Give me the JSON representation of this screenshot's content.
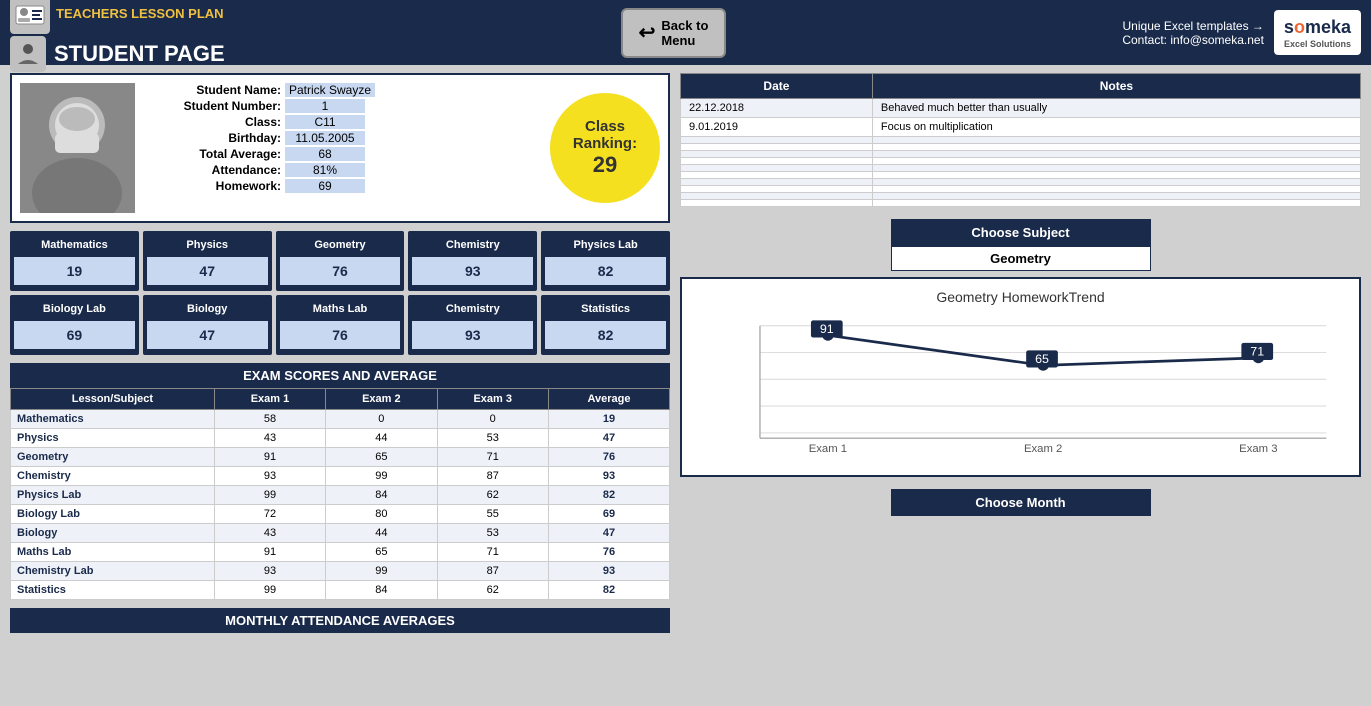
{
  "header": {
    "top_title": "TEACHERS LESSON PLAN",
    "bottom_title": "STUDENT PAGE",
    "back_label": "Back to",
    "back_label2": "Menu",
    "unique_text": "Unique Excel templates →",
    "contact_text": "Contact: info@someka.net",
    "brand_name": "someka",
    "brand_sub": "Excel Solutions"
  },
  "student": {
    "name_label": "Student Name:",
    "number_label": "Student Number:",
    "class_label": "Class:",
    "birthday_label": "Birthday:",
    "avg_label": "Total Average:",
    "attendance_label": "Attendance:",
    "homework_label": "Homework:",
    "name_value": "Patrick Swayze",
    "number_value": "1",
    "class_value": "C11",
    "birthday_value": "11.05.2005",
    "avg_value": "68",
    "attendance_value": "81%",
    "homework_value": "69",
    "ranking_line1": "Class",
    "ranking_line2": "Ranking:",
    "ranking_value": "29"
  },
  "subjects": [
    {
      "name": "Mathematics",
      "score": "19"
    },
    {
      "name": "Physics",
      "score": "47"
    },
    {
      "name": "Geometry",
      "score": "76"
    },
    {
      "name": "Chemistry",
      "score": "93"
    },
    {
      "name": "Physics Lab",
      "score": "82"
    },
    {
      "name": "Biology Lab",
      "score": "69"
    },
    {
      "name": "Biology",
      "score": "47"
    },
    {
      "name": "Maths Lab",
      "score": "76"
    },
    {
      "name": "Chemistry",
      "score": "93"
    },
    {
      "name": "Statistics",
      "score": "82"
    }
  ],
  "exam_table": {
    "title": "EXAM SCORES AND AVERAGE",
    "headers": [
      "Lesson/Subject",
      "Exam 1",
      "Exam 2",
      "Exam 3",
      "Average"
    ],
    "rows": [
      {
        "subject": "Mathematics",
        "e1": "58",
        "e2": "0",
        "e3": "0",
        "avg": "19"
      },
      {
        "subject": "Physics",
        "e1": "43",
        "e2": "44",
        "e3": "53",
        "avg": "47"
      },
      {
        "subject": "Geometry",
        "e1": "91",
        "e2": "65",
        "e3": "71",
        "avg": "76"
      },
      {
        "subject": "Chemistry",
        "e1": "93",
        "e2": "99",
        "e3": "87",
        "avg": "93"
      },
      {
        "subject": "Physics Lab",
        "e1": "99",
        "e2": "84",
        "e3": "62",
        "avg": "82"
      },
      {
        "subject": "Biology Lab",
        "e1": "72",
        "e2": "80",
        "e3": "55",
        "avg": "69"
      },
      {
        "subject": "Biology",
        "e1": "43",
        "e2": "44",
        "e3": "53",
        "avg": "47"
      },
      {
        "subject": "Maths Lab",
        "e1": "91",
        "e2": "65",
        "e3": "71",
        "avg": "76"
      },
      {
        "subject": "Chemistry Lab",
        "e1": "93",
        "e2": "99",
        "e3": "87",
        "avg": "93"
      },
      {
        "subject": "Statistics",
        "e1": "99",
        "e2": "84",
        "e3": "62",
        "avg": "82"
      }
    ]
  },
  "monthly": {
    "title": "MONTHLY ATTENDANCE AVERAGES"
  },
  "notes": {
    "col1": "Date",
    "col2": "Notes",
    "rows": [
      {
        "date": "22.12.2018",
        "note": "Behaved much better than usually"
      },
      {
        "date": "9.01.2019",
        "note": "Focus on multiplication"
      },
      {
        "date": "",
        "note": ""
      },
      {
        "date": "",
        "note": ""
      },
      {
        "date": "",
        "note": ""
      },
      {
        "date": "",
        "note": ""
      },
      {
        "date": "",
        "note": ""
      },
      {
        "date": "",
        "note": ""
      },
      {
        "date": "",
        "note": ""
      },
      {
        "date": "",
        "note": ""
      },
      {
        "date": "",
        "note": ""
      },
      {
        "date": "",
        "note": ""
      }
    ]
  },
  "choose_subject": {
    "label": "Choose Subject",
    "value": "Geometry"
  },
  "chart": {
    "title": "Geometry HomeworkTrend",
    "points": [
      {
        "label": "Exam 1",
        "value": 91
      },
      {
        "label": "Exam 2",
        "value": 65
      },
      {
        "label": "Exam 3",
        "value": 71
      }
    ]
  },
  "choose_month": {
    "label": "Choose Month"
  }
}
